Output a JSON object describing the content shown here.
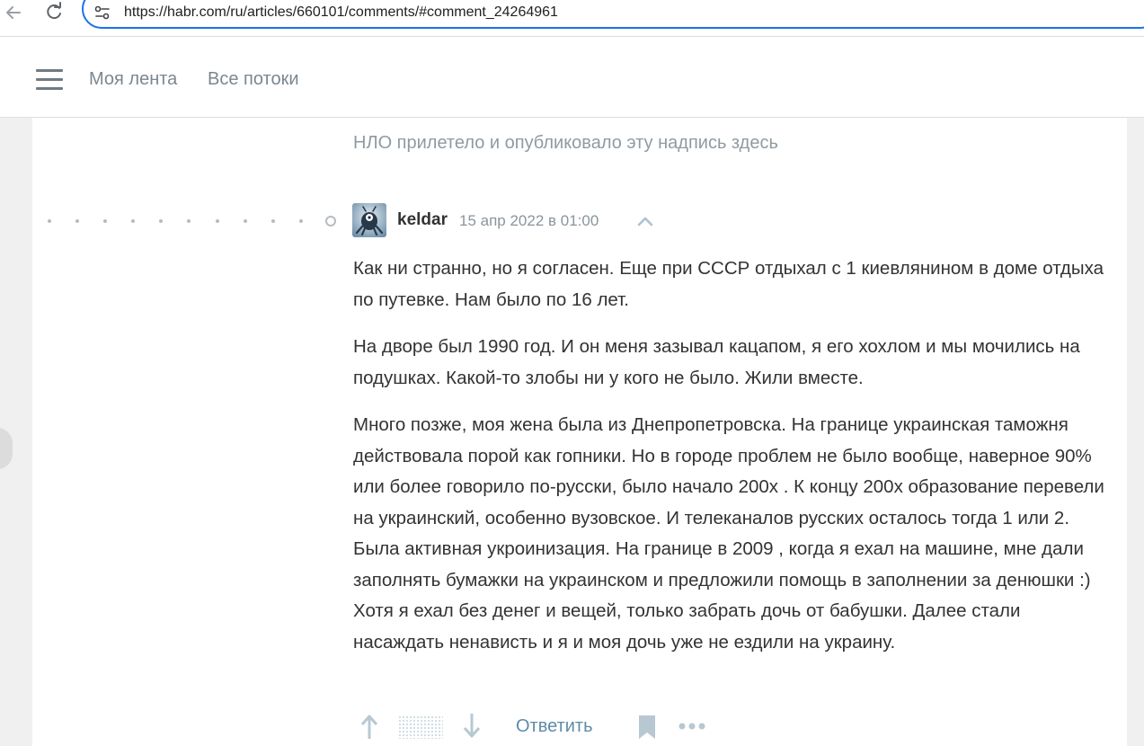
{
  "browser": {
    "url": "https://habr.com/ru/articles/660101/comments/#comment_24264961"
  },
  "header": {
    "nav": [
      "Моя лента",
      "Все потоки"
    ]
  },
  "ufo_message": "НЛО прилетело и опубликовало эту надпись здесь",
  "comment": {
    "author": "keldar",
    "date": "15 апр 2022 в 01:00",
    "paragraphs": [
      "Как ни странно, но я согласен. Еще при СССР отдыхал с 1 киевлянином в доме отдыха по путевке. Нам было по 16 лет.",
      "На дворе был 1990 год. И он меня зазывал кацапом, я его хохлом и мы мочились на подушках. Какой-то злобы ни у кого не было. Жили вместе.",
      "Много позже, моя жена была из Днепропетровска. На границе украинская таможня действовала порой как гопники. Но в городе проблем не было вообще, наверное 90% или более говорило по-русски, было начало 200х . К концу 200х образование перевели на украинский, особенно вузовское. И телеканалов русских осталось тогда 1 или 2. Была активная укроинизация. На границе в 2009 , когда я ехал на машине, мне дали заполнять бумажки на украинском и предложили помощь в заполнении за денюшки :) Хотя я ехал без денег и вещей, только забрать дочь от бабушки. Далее стали насаждать ненависть и я и моя дочь уже не ездили на украину."
    ],
    "reply_label": "Ответить"
  },
  "icons": {
    "back": "back-arrow-icon",
    "reload": "reload-icon",
    "site_info": "tune-icon",
    "menu": "hamburger-menu-icon",
    "parent": "chevron-up-icon",
    "vote_up": "arrow-up-icon",
    "vote_down": "arrow-down-icon",
    "bookmark": "bookmark-icon",
    "more": "more-dots-icon"
  },
  "colors": {
    "url_focus": "#1a73e8",
    "reply_link": "#5e8ca8",
    "nav_text": "#7b8790",
    "body_text": "#333333"
  }
}
